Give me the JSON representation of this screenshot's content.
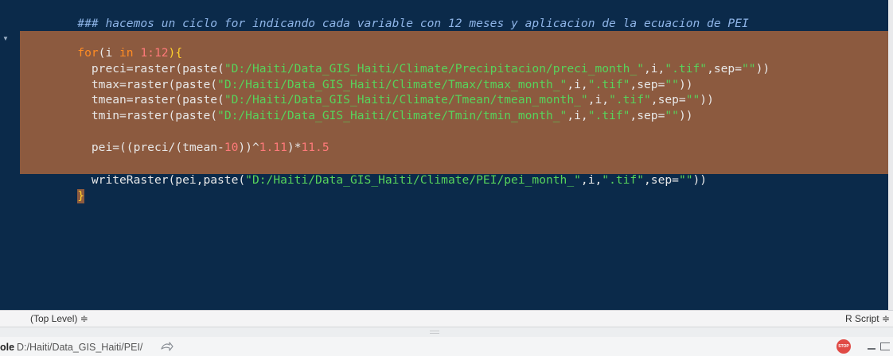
{
  "editor": {
    "comment_line": "### hacemos un ciclo for indicando cada variable con 12 meses y aplicacion de la ecuacion de PEI",
    "line_for": {
      "keyword": "for",
      "open": "(i ",
      "in_kw": "in",
      "range": "1:12",
      "close": "){"
    },
    "line_preci": {
      "indent": "  ",
      "prefix": "preci=raster(paste(",
      "path": "\"D:/Haiti/Data_GIS_Haiti/Climate/Precipitacion/preci_month_\"",
      "mid": ",i,",
      "ext": "\".tif\"",
      "sep_label": ",sep=",
      "sep_val": "\"\"",
      "close": "))"
    },
    "line_tmax": {
      "indent": "  ",
      "prefix": "tmax=raster(paste(",
      "path": "\"D:/Haiti/Data_GIS_Haiti/Climate/Tmax/tmax_month_\"",
      "mid": ",i,",
      "ext": "\".tif\"",
      "sep_label": ",sep=",
      "sep_val": "\"\"",
      "close": "))"
    },
    "line_tmean": {
      "indent": "  ",
      "prefix": "tmean=raster(paste(",
      "path": "\"D:/Haiti/Data_GIS_Haiti/Climate/Tmean/tmean_month_\"",
      "mid": ",i,",
      "ext": "\".tif\"",
      "sep_label": ",sep=",
      "sep_val": "\"\"",
      "close": "))"
    },
    "line_tmin": {
      "indent": "  ",
      "prefix": "tmin=raster(paste(",
      "path": "\"D:/Haiti/Data_GIS_Haiti/Climate/Tmin/tmin_month_\"",
      "mid": ",i,",
      "ext": "\".tif\"",
      "sep_label": ",sep=",
      "sep_val": "\"\"",
      "close": "))"
    },
    "line_pei": {
      "indent": "  ",
      "part1": "pei=((preci/(tmean-",
      "n1": "10",
      "part2": "))^",
      "n2": "1.11",
      "part3": ")*",
      "n3": "11.5"
    },
    "line_write": {
      "indent": "  ",
      "prefix": "writeRaster(pei,paste(",
      "path": "\"D:/Haiti/Data_GIS_Haiti/Climate/PEI/pei_month_\"",
      "mid": ",i,",
      "ext": "\".tif\"",
      "sep_label": ",sep=",
      "sep_val": "\"\"",
      "close": "))"
    },
    "closing_brace": "}",
    "fold_glyph": "▼"
  },
  "status_bar": {
    "scope": "(Top Level) ≑",
    "file_type": "R Script ≑"
  },
  "console": {
    "title": "ole",
    "path": "D:/Haiti/Data_GIS_Haiti/PEI/",
    "stop_label": "STOP"
  },
  "colors": {
    "editor_background": "#0b2a4a",
    "selection": "#8c5a3f",
    "keyword": "#ff8c24",
    "string": "#57d35b",
    "number": "#ff7a7a",
    "comment": "#8fb5e8",
    "brace": "#ffd12c",
    "stop_button": "#e04a45"
  }
}
